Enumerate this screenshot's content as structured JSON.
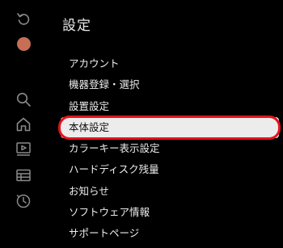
{
  "app": {
    "title": "設定"
  },
  "rail": {
    "icons": [
      {
        "name": "back-icon"
      },
      {
        "name": "avatar"
      },
      {
        "name": "search-icon"
      },
      {
        "name": "home-icon"
      },
      {
        "name": "video-icon"
      },
      {
        "name": "guide-icon"
      },
      {
        "name": "history-icon"
      }
    ],
    "avatar_color": "#c76e57"
  },
  "menu": {
    "items": [
      {
        "label": "アカウント"
      },
      {
        "label": "機器登録・選択"
      },
      {
        "label": "設置設定"
      },
      {
        "label": "本体設定",
        "selected": true
      },
      {
        "label": "カラーキー表示設定"
      },
      {
        "label": "ハードディスク残量"
      },
      {
        "label": "お知らせ"
      },
      {
        "label": "ソフトウェア情報"
      },
      {
        "label": "サポートページ"
      }
    ]
  },
  "colors": {
    "background": "#000000",
    "selected_bg": "#ececec",
    "highlight_ring": "#e3141a"
  }
}
